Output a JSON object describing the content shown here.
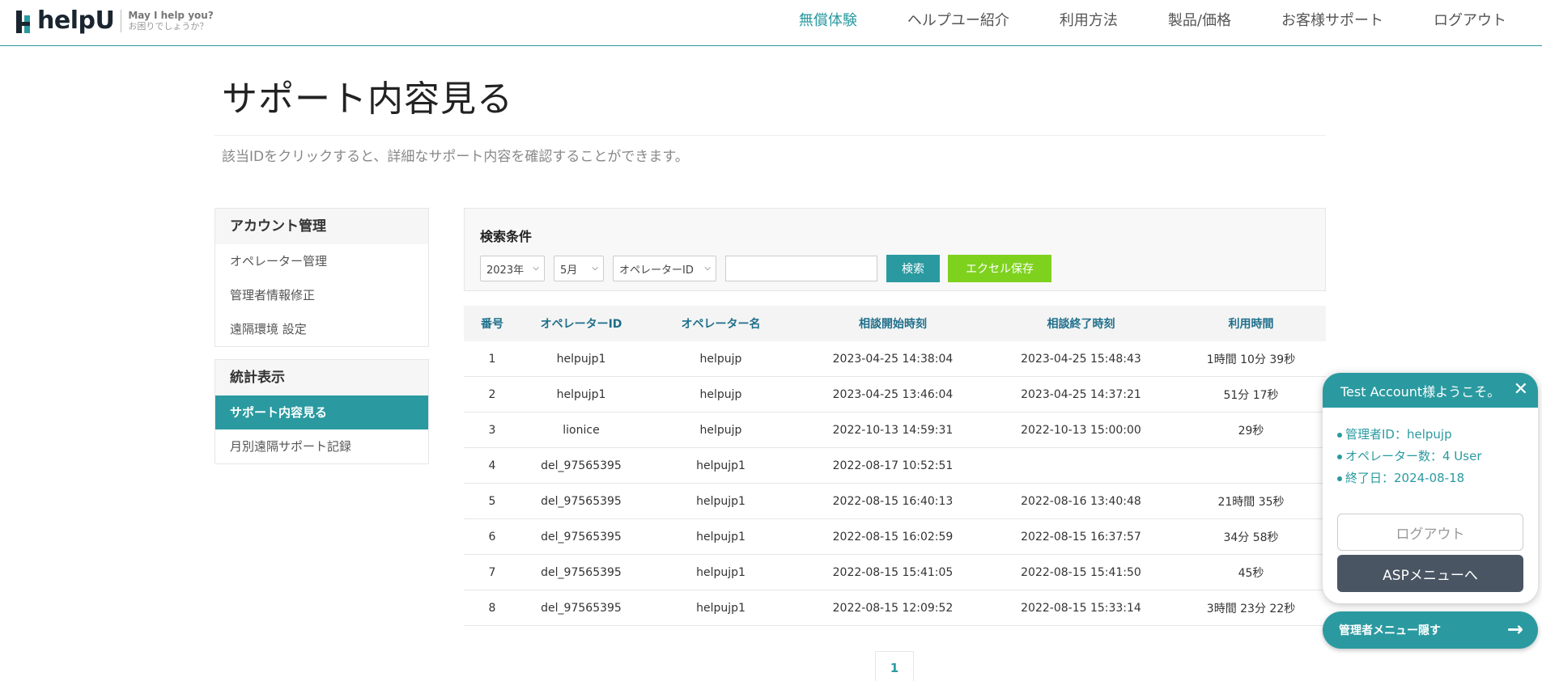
{
  "header": {
    "logo_text": "helpU",
    "tagline1": "May I help you?",
    "tagline2": "お困りでしょうか？",
    "nav": [
      {
        "label": "無償体験"
      },
      {
        "label": "ヘルプユー紹介"
      },
      {
        "label": "利用方法"
      },
      {
        "label": "製品/価格"
      },
      {
        "label": "お客様サポート"
      },
      {
        "label": "ログアウト"
      }
    ]
  },
  "page": {
    "title": "サポート内容見る",
    "description": "該当IDをクリックすると、詳細なサポート内容を確認することができます。"
  },
  "sidebar": {
    "groups": [
      {
        "head": "アカウント管理",
        "items": [
          "オペレーター管理",
          "管理者情報修正",
          "遠隔環境 設定"
        ]
      },
      {
        "head": "統計表示",
        "items": [
          "サポート内容見る",
          "月別遠隔サポート記録"
        ]
      }
    ]
  },
  "search": {
    "title": "検索条件",
    "year": "2023年",
    "month": "5月",
    "field": "オペレーターID",
    "query": "",
    "search_label": "検索",
    "excel_label": "エクセル保存"
  },
  "table": {
    "headers": [
      "番号",
      "オペレーターID",
      "オペレーター名",
      "相談開始時刻",
      "相談終了時刻",
      "利用時間"
    ],
    "rows": [
      [
        "1",
        "helpujp1",
        "helpujp",
        "2023-04-25 14:38:04",
        "2023-04-25 15:48:43",
        "1時間 10分 39秒"
      ],
      [
        "2",
        "helpujp1",
        "helpujp",
        "2023-04-25 13:46:04",
        "2023-04-25 14:37:21",
        "51分 17秒"
      ],
      [
        "3",
        "lionice",
        "helpujp",
        "2022-10-13 14:59:31",
        "2022-10-13 15:00:00",
        "29秒"
      ],
      [
        "4",
        "del_97565395",
        "helpujp1",
        "2022-08-17 10:52:51",
        "",
        ""
      ],
      [
        "5",
        "del_97565395",
        "helpujp1",
        "2022-08-15 16:40:13",
        "2022-08-16 13:40:48",
        "21時間 35秒"
      ],
      [
        "6",
        "del_97565395",
        "helpujp1",
        "2022-08-15 16:02:59",
        "2022-08-15 16:37:57",
        "34分 58秒"
      ],
      [
        "7",
        "del_97565395",
        "helpujp1",
        "2022-08-15 15:41:05",
        "2022-08-15 15:41:50",
        "45秒"
      ],
      [
        "8",
        "del_97565395",
        "helpujp1",
        "2022-08-15 12:09:52",
        "2022-08-15 15:33:14",
        "3時間 23分 22秒"
      ]
    ]
  },
  "pager": {
    "current": "1"
  },
  "widget": {
    "greeting": "Test Account様ようこそ。",
    "admin_id": "管理者ID：helpujp",
    "operator_count": "オペレーター数：4 User",
    "end_date": "終了日：2024-08-18",
    "logout_label": "ログアウト",
    "asp_label": "ASPメニューへ",
    "hide_label": "管理者メニュー隠す"
  },
  "colors": {
    "accent": "#2a9aa0",
    "excel": "#7ed21e",
    "dark_button": "#4a5563"
  }
}
